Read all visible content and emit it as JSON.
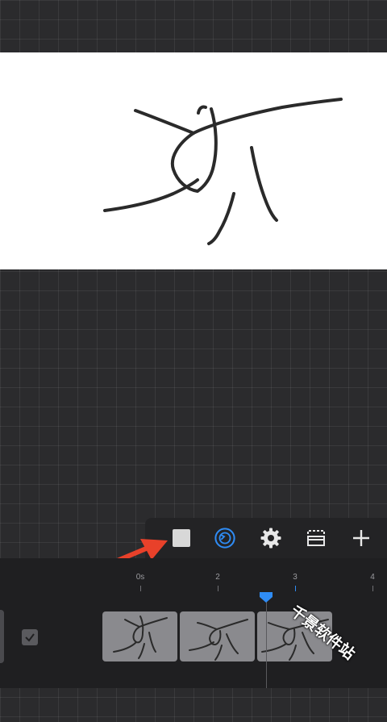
{
  "toolbar": {
    "tools": [
      "stop-square",
      "onion-skin",
      "settings",
      "frame-options",
      "add-frame"
    ]
  },
  "timeline": {
    "ticks": [
      {
        "label": "0s"
      },
      {
        "label": "2"
      },
      {
        "label": "3"
      },
      {
        "label": "4"
      }
    ]
  },
  "watermark": {
    "text": "千景软件站"
  },
  "colors": {
    "accent": "#2f8cf5",
    "arrow": "#e8412a",
    "canvas": "#ffffff",
    "background": "#2b2b2d"
  }
}
